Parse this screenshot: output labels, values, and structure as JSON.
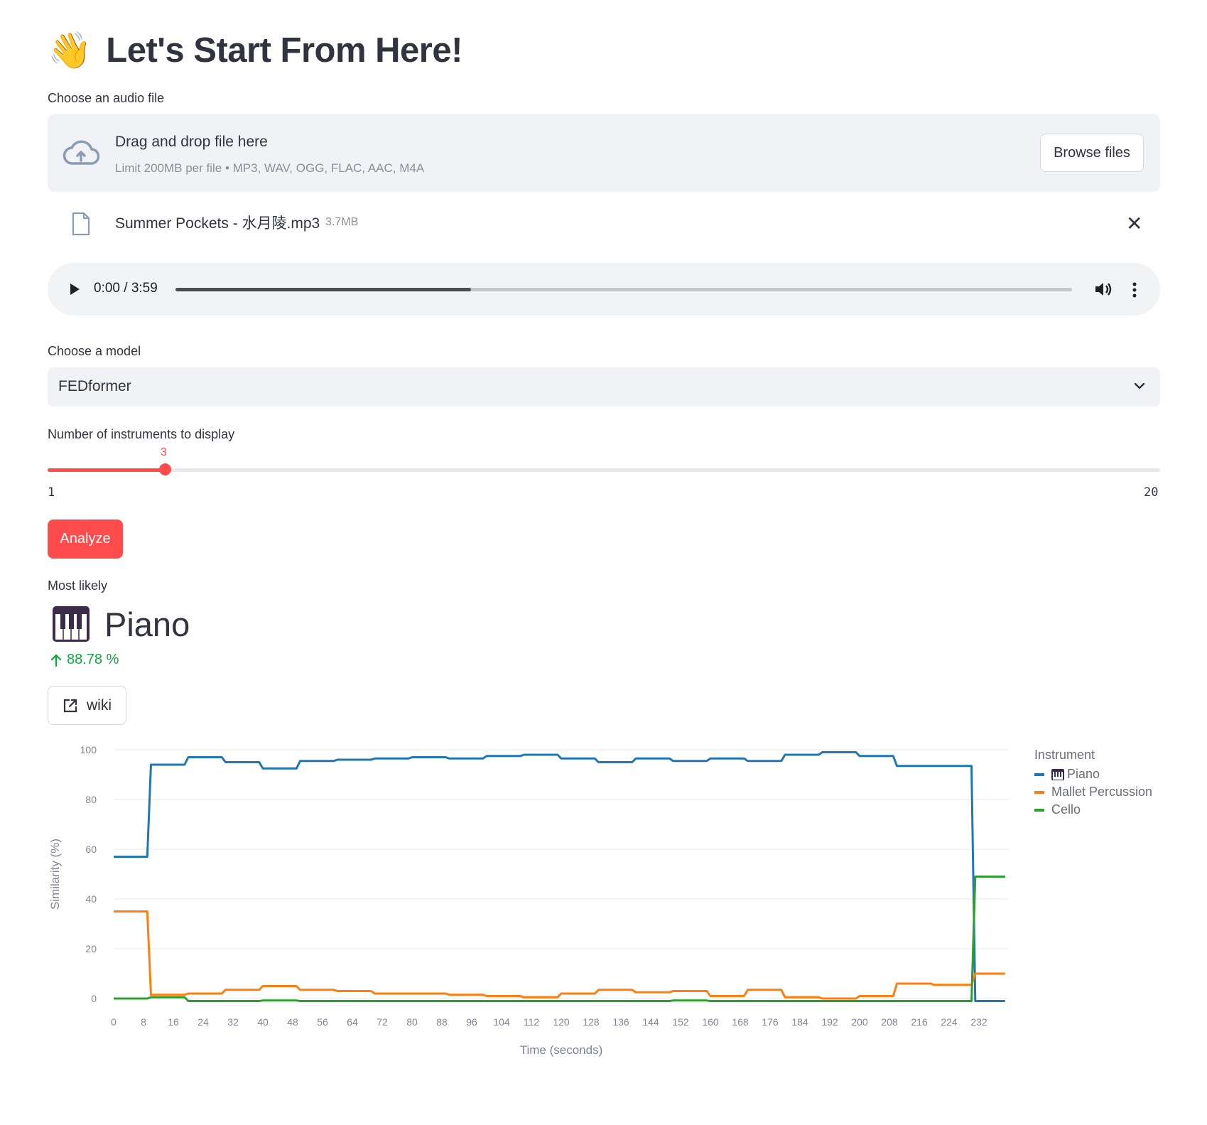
{
  "header": {
    "emoji": "👋",
    "title": "Let's Start From Here!"
  },
  "uploader": {
    "label": "Choose an audio file",
    "drop_text": "Drag and drop file here",
    "limit_text": "Limit 200MB per file • MP3, WAV, OGG, FLAC, AAC, M4A",
    "browse_label": "Browse files",
    "icon": "cloud-upload-icon"
  },
  "file": {
    "name": "Summer Pockets - 水月陵.mp3",
    "size": "3.7MB",
    "icon": "file-icon",
    "close_icon": "close-icon"
  },
  "player": {
    "time": "0:00 / 3:59",
    "buffered_fraction": 0.33
  },
  "model": {
    "label": "Choose a model",
    "value": "FEDformer"
  },
  "slider": {
    "label": "Number of instruments to display",
    "value": 3,
    "min": 1,
    "max": 20,
    "min_label": "1",
    "max_label": "20",
    "value_label": "3"
  },
  "analyze_label": "Analyze",
  "metric": {
    "label": "Most likely",
    "value": "Piano",
    "delta": "88.78 %"
  },
  "wiki_label": "wiki",
  "colors": {
    "piano": "#1f77b4",
    "mallet": "#ff7f0e",
    "cello": "#2ca02c",
    "accent": "#ff4b4b",
    "delta": "#09ab3b"
  },
  "chart_data": {
    "type": "line",
    "xlabel": "Time (seconds)",
    "ylabel": "Similarity (%)",
    "xlim": [
      0,
      240
    ],
    "ylim": [
      0,
      100
    ],
    "x_ticks": [
      0,
      8,
      16,
      24,
      32,
      40,
      48,
      56,
      64,
      72,
      80,
      88,
      96,
      104,
      112,
      120,
      128,
      136,
      144,
      152,
      160,
      168,
      176,
      184,
      192,
      200,
      208,
      216,
      224,
      232
    ],
    "y_ticks": [
      0,
      20,
      40,
      60,
      80,
      100
    ],
    "legend_title": "Instrument",
    "legend_position": "right",
    "series": [
      {
        "name": "Piano",
        "x": [
          0,
          9,
          10,
          19,
          20,
          29,
          30,
          39,
          40,
          49,
          50,
          59,
          60,
          69,
          70,
          79,
          80,
          89,
          90,
          99,
          100,
          109,
          110,
          119,
          120,
          129,
          130,
          139,
          140,
          149,
          150,
          159,
          160,
          169,
          170,
          179,
          180,
          189,
          190,
          199,
          200,
          209,
          210,
          219,
          220,
          229,
          230,
          231,
          239
        ],
        "y": [
          57,
          57,
          94,
          94,
          97,
          97,
          95,
          95,
          92.5,
          92.5,
          95.5,
          95.5,
          96,
          96,
          96.5,
          96.5,
          97,
          97,
          96.5,
          96.5,
          97.5,
          97.5,
          98,
          98,
          96.5,
          96.5,
          95,
          95,
          96.5,
          96.5,
          95.5,
          95.5,
          96.5,
          96.5,
          95.5,
          95.5,
          98,
          98,
          99,
          99,
          97.5,
          97.5,
          93.5,
          93.5,
          93.5,
          93.5,
          93.5,
          -1,
          -1
        ]
      },
      {
        "name": "Mallet Percussion",
        "x": [
          0,
          9,
          10,
          19,
          20,
          29,
          30,
          39,
          40,
          49,
          50,
          59,
          60,
          69,
          70,
          79,
          80,
          89,
          90,
          99,
          100,
          109,
          110,
          119,
          120,
          129,
          130,
          139,
          140,
          149,
          150,
          159,
          160,
          169,
          170,
          179,
          180,
          189,
          190,
          199,
          200,
          209,
          210,
          219,
          220,
          229,
          230,
          231,
          239
        ],
        "y": [
          35,
          35,
          1.5,
          1.5,
          2,
          2,
          3.5,
          3.5,
          5,
          5,
          3.5,
          3.5,
          3,
          3,
          2,
          2,
          2,
          2,
          1.5,
          1.5,
          1,
          1,
          0.5,
          0.5,
          2,
          2,
          3.5,
          3.5,
          2.5,
          2.5,
          3,
          3,
          1,
          1,
          3.5,
          3.5,
          0.5,
          0.5,
          0,
          0,
          1,
          1,
          6,
          6,
          5.5,
          5.5,
          5.5,
          10,
          10
        ]
      },
      {
        "name": "Cello",
        "x": [
          0,
          9,
          10,
          19,
          20,
          29,
          30,
          39,
          40,
          49,
          50,
          59,
          60,
          69,
          70,
          79,
          80,
          89,
          90,
          99,
          100,
          109,
          110,
          119,
          120,
          129,
          130,
          139,
          140,
          149,
          150,
          159,
          160,
          169,
          170,
          179,
          180,
          189,
          190,
          199,
          200,
          209,
          210,
          219,
          220,
          229,
          230,
          231,
          239
        ],
        "y": [
          0,
          0,
          0.5,
          0.5,
          -1,
          -1,
          -1,
          -1,
          -0.8,
          -0.8,
          -1,
          -1,
          -1,
          -1,
          -1,
          -1,
          -1,
          -1,
          -1,
          -1,
          -1,
          -1,
          -1,
          -1,
          -1,
          -1,
          -1,
          -1,
          -1,
          -1,
          -0.8,
          -0.8,
          -1,
          -1,
          -1,
          -1,
          -1,
          -1,
          -1,
          -1,
          -1,
          -1,
          -1,
          -1,
          -1,
          -1,
          -1,
          49,
          49
        ]
      }
    ]
  }
}
